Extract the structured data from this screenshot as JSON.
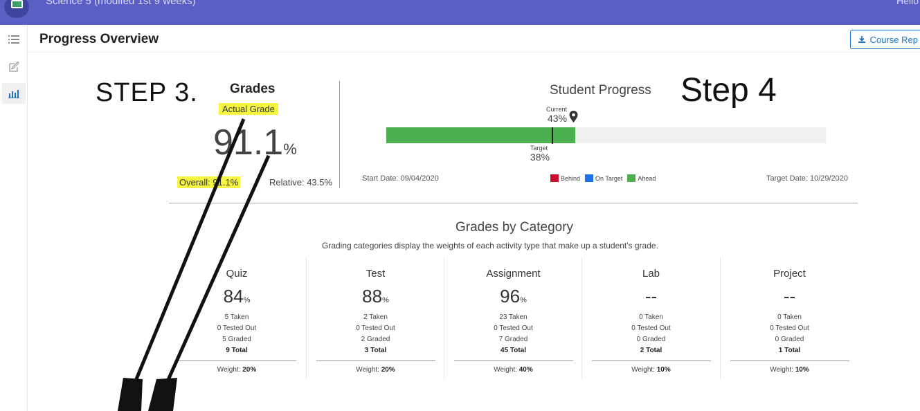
{
  "topbar": {
    "course_title": "Science 5 (modifed 1st 9 weeks)",
    "user_greeting": "Hello"
  },
  "sidenav": {
    "items": [
      "list-icon",
      "edit-icon",
      "chart-icon"
    ],
    "active": "chart-icon"
  },
  "header": {
    "title": "Progress Overview",
    "course_report_button": "Course Rep"
  },
  "annotations": {
    "step3": "STEP 3.",
    "step4": "Step 4"
  },
  "grades": {
    "title": "Grades",
    "actual_label": "Actual Grade",
    "value": "91.1",
    "percent_sign": "%",
    "overall": "Overall: 91.1%",
    "relative": "Relative: 43.5%"
  },
  "progress": {
    "title": "Student Progress",
    "current_label": "Current",
    "current_value": "43%",
    "current_fraction": 0.43,
    "target_label": "Target",
    "target_value": "38%",
    "target_fraction": 0.38,
    "start_date": "Start Date: 09/04/2020",
    "target_date": "Target Date: 10/29/2020",
    "legend": [
      {
        "label": "Behind",
        "color": "#c8102e"
      },
      {
        "label": "On Target",
        "color": "#1a73e8"
      },
      {
        "label": "Ahead",
        "color": "#4caf50"
      }
    ]
  },
  "categories": {
    "title": "Grades by Category",
    "subtitle": "Grading categories display the weights of each activity type that make up a student's grade.",
    "items": [
      {
        "name": "Quiz",
        "score": "84",
        "unit": "%",
        "taken": "5 Taken",
        "tested_out": "0 Tested Out",
        "graded": "5 Graded",
        "total": "9 Total",
        "weight_label": "Weight:",
        "weight": "20%"
      },
      {
        "name": "Test",
        "score": "88",
        "unit": "%",
        "taken": "2 Taken",
        "tested_out": "0 Tested Out",
        "graded": "2 Graded",
        "total": "3 Total",
        "weight_label": "Weight:",
        "weight": "20%"
      },
      {
        "name": "Assignment",
        "score": "96",
        "unit": "%",
        "taken": "23 Taken",
        "tested_out": "0 Tested Out",
        "graded": "7 Graded",
        "total": "45 Total",
        "weight_label": "Weight:",
        "weight": "40%"
      },
      {
        "name": "Lab",
        "score": "--",
        "unit": "",
        "taken": "0 Taken",
        "tested_out": "0 Tested Out",
        "graded": "0 Graded",
        "total": "2 Total",
        "weight_label": "Weight:",
        "weight": "10%"
      },
      {
        "name": "Project",
        "score": "--",
        "unit": "",
        "taken": "0 Taken",
        "tested_out": "0 Tested Out",
        "graded": "0 Graded",
        "total": "1 Total",
        "weight_label": "Weight:",
        "weight": "10%"
      }
    ]
  }
}
